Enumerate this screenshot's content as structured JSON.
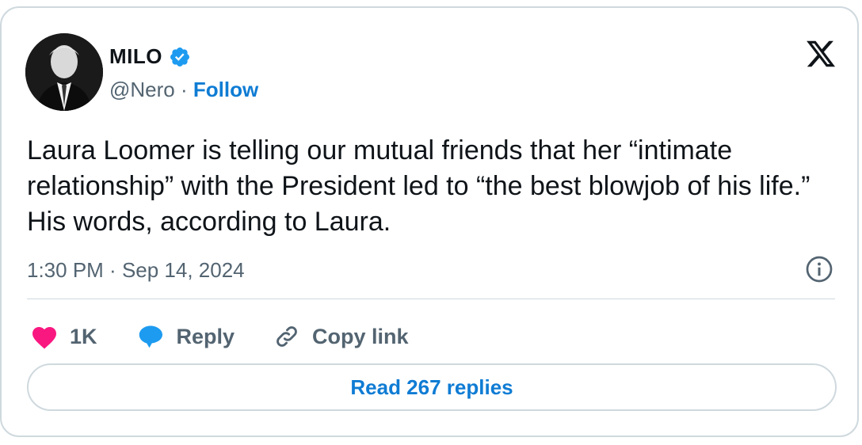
{
  "author": {
    "name": "MILO",
    "handle": "@Nero",
    "separator": " · ",
    "follow_label": "Follow",
    "verified_color": "#1d9bf0"
  },
  "tweet": {
    "text": "Laura Loomer is telling our mutual friends that her “intimate relationship” with the President led to “the best blowjob of his life.” His words, according to Laura.",
    "time": "1:30 PM",
    "date_separator": " · ",
    "date": "Sep 14, 2024"
  },
  "actions": {
    "likes_count": "1K",
    "reply_label": "Reply",
    "copy_link_label": "Copy link",
    "like_color": "#f91880",
    "reply_color": "#1d9bf0"
  },
  "footer": {
    "read_replies_label": "Read 267 replies"
  },
  "icons": [
    "avatar",
    "verified-badge-icon",
    "x-logo-icon",
    "info-icon",
    "heart-icon",
    "reply-bubble-icon",
    "link-icon"
  ]
}
